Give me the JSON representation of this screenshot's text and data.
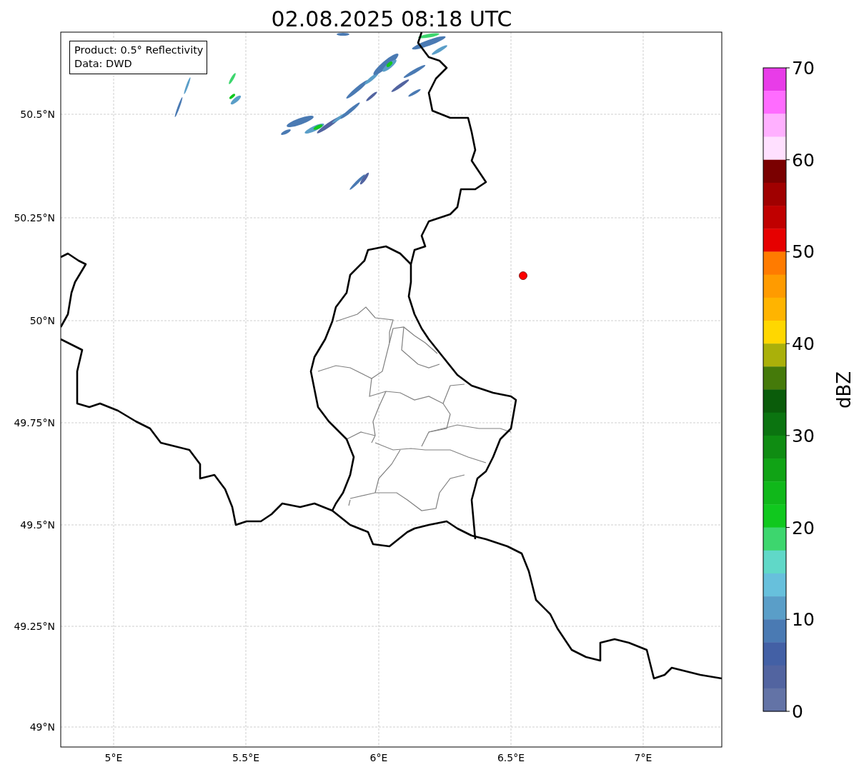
{
  "title": "02.08.2025 08:18 UTC",
  "map": {
    "legend_lines": [
      "Product: 0.5° Reflectivity",
      "Data: DWD"
    ],
    "lat_ticks": [
      "50.5°N",
      "50.25°N",
      "50°N",
      "49.75°N",
      "49.5°N",
      "49.25°N",
      "49°N"
    ],
    "lon_ticks": [
      "5°E",
      "5.5°E",
      "6°E",
      "6.5°E",
      "7°E"
    ]
  },
  "colorbar": {
    "label": "dBZ",
    "ticks": [
      "70",
      "60",
      "50",
      "40",
      "30",
      "20",
      "10",
      "0"
    ],
    "bands": [
      {
        "color": "#e83ce8"
      },
      {
        "color": "#ff6cff"
      },
      {
        "color": "#ffb0ff"
      },
      {
        "color": "#ffe0ff"
      },
      {
        "color": "#7a0000"
      },
      {
        "color": "#a00000"
      },
      {
        "color": "#c00000"
      },
      {
        "color": "#e60000"
      },
      {
        "color": "#ff7b00"
      },
      {
        "color": "#ff9b00"
      },
      {
        "color": "#ffb400"
      },
      {
        "color": "#ffd700"
      },
      {
        "color": "#aab00a"
      },
      {
        "color": "#457a0a"
      },
      {
        "color": "#0a5c0a"
      },
      {
        "color": "#0b7410"
      },
      {
        "color": "#0f8c12"
      },
      {
        "color": "#10a315"
      },
      {
        "color": "#10b81a"
      },
      {
        "color": "#10c81e"
      },
      {
        "color": "#3dd66e"
      },
      {
        "color": "#60d8c8"
      },
      {
        "color": "#67c0dc"
      },
      {
        "color": "#5a9ec8"
      },
      {
        "color": "#4a7ab3"
      },
      {
        "color": "#4360a5"
      },
      {
        "color": "#5264a0"
      },
      {
        "color": "#6373a6"
      }
    ]
  }
}
